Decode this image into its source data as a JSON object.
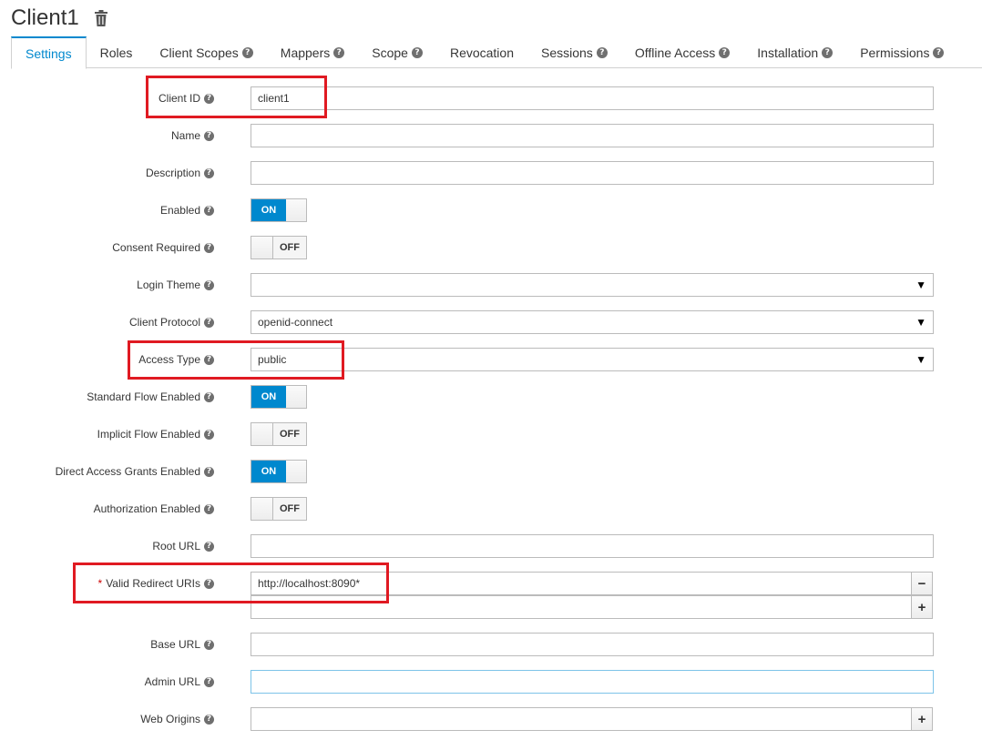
{
  "header": {
    "title": "Client1"
  },
  "tabs": [
    {
      "label": "Settings",
      "help": false
    },
    {
      "label": "Roles",
      "help": false
    },
    {
      "label": "Client Scopes",
      "help": true
    },
    {
      "label": "Mappers",
      "help": true
    },
    {
      "label": "Scope",
      "help": true
    },
    {
      "label": "Revocation",
      "help": false
    },
    {
      "label": "Sessions",
      "help": true
    },
    {
      "label": "Offline Access",
      "help": true
    },
    {
      "label": "Installation",
      "help": true
    },
    {
      "label": "Permissions",
      "help": true
    }
  ],
  "help_glyph": "?",
  "required_mark": "*",
  "toggle_on_label": "ON",
  "toggle_off_label": "OFF",
  "select_arrow": "▼",
  "minus_glyph": "−",
  "plus_glyph": "+",
  "fields": {
    "client_id": {
      "label": "Client ID",
      "value": "client1"
    },
    "name": {
      "label": "Name",
      "value": ""
    },
    "description": {
      "label": "Description",
      "value": ""
    },
    "enabled": {
      "label": "Enabled",
      "on": true
    },
    "consent_required": {
      "label": "Consent Required",
      "on": false
    },
    "login_theme": {
      "label": "Login Theme",
      "value": ""
    },
    "client_protocol": {
      "label": "Client Protocol",
      "value": "openid-connect"
    },
    "access_type": {
      "label": "Access Type",
      "value": "public"
    },
    "standard_flow": {
      "label": "Standard Flow Enabled",
      "on": true
    },
    "implicit_flow": {
      "label": "Implicit Flow Enabled",
      "on": false
    },
    "direct_access": {
      "label": "Direct Access Grants Enabled",
      "on": true
    },
    "authorization": {
      "label": "Authorization Enabled",
      "on": false
    },
    "root_url": {
      "label": "Root URL",
      "value": ""
    },
    "redirect_uris": {
      "label": "Valid Redirect URIs",
      "value": "http://localhost:8090*",
      "new_value": ""
    },
    "base_url": {
      "label": "Base URL",
      "value": ""
    },
    "admin_url": {
      "label": "Admin URL",
      "value": ""
    },
    "web_origins": {
      "label": "Web Origins",
      "value": ""
    }
  }
}
